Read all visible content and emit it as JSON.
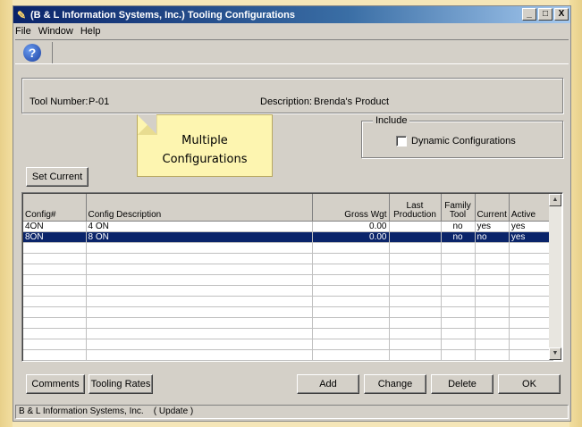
{
  "window": {
    "title": "(B & L Information Systems, Inc.) Tooling Configurations",
    "app_icon": "wand-icon",
    "controls": [
      "_",
      "□",
      "X"
    ]
  },
  "menu": [
    "File",
    "Window",
    "Help"
  ],
  "toolbar": {
    "help_icon": "help-icon",
    "help_glyph": "?"
  },
  "header": {
    "tool_number_label": "Tool Number:",
    "tool_number_value": "P-01",
    "description_label": "Description:",
    "description_value": "Brenda's Product"
  },
  "include": {
    "group_label": "Include",
    "dynamic_label": "Dynamic Configurations",
    "dynamic_checked": false
  },
  "callout": {
    "line1": "Multiple",
    "line2": "Configurations"
  },
  "set_current_label": "Set Current",
  "table": {
    "columns": [
      {
        "key": "config",
        "label": "Config#",
        "align": "left"
      },
      {
        "key": "desc",
        "label": "Config Description",
        "align": "left"
      },
      {
        "key": "gross",
        "label": "Gross Wgt",
        "align": "right"
      },
      {
        "key": "last",
        "label": "Last Production",
        "align": "center"
      },
      {
        "key": "family",
        "label": "Family Tool",
        "align": "center"
      },
      {
        "key": "current",
        "label": "Current",
        "align": "left"
      },
      {
        "key": "active",
        "label": "Active",
        "align": "left"
      }
    ],
    "rows": [
      {
        "config": "4ON",
        "desc": "4 ON",
        "gross": "0.00",
        "last": "",
        "family": "no",
        "current": "yes",
        "active": "yes",
        "selected": false
      },
      {
        "config": "8ON",
        "desc": "8 ON",
        "gross": "0.00",
        "last": "",
        "family": "no",
        "current": "no",
        "active": "yes",
        "selected": true
      }
    ],
    "empty_rows": 11
  },
  "buttons": {
    "comments": "Comments",
    "tooling_rates": "Tooling Rates",
    "add": "Add",
    "change": "Change",
    "delete": "Delete",
    "ok": "OK"
  },
  "status": "B & L Information Systems, Inc.    ( Update )"
}
